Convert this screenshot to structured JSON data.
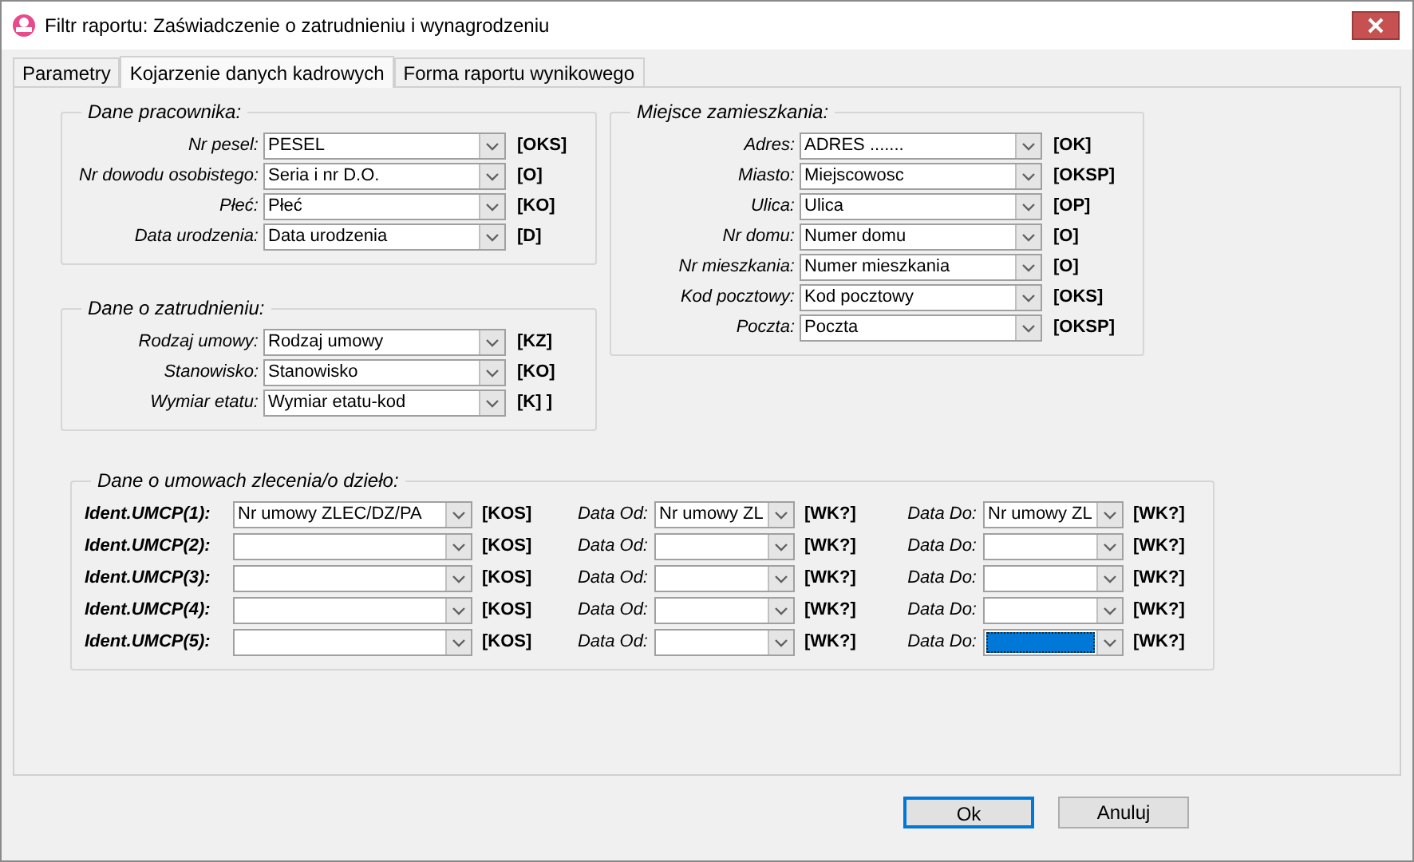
{
  "window": {
    "title": "Filtr raportu: Zaświadczenie o zatrudnieniu i wynagrodzeniu"
  },
  "tabs": [
    {
      "label": "Parametry",
      "selected": false
    },
    {
      "label": "Kojarzenie danych kadrowych",
      "selected": true
    },
    {
      "label": "Forma raportu wynikowego",
      "selected": false
    }
  ],
  "groups": [
    {
      "title": "Dane pracownika:",
      "fields": [
        {
          "label": "Nr pesel:",
          "value": "PESEL",
          "tag": "[OKS]"
        },
        {
          "label": "Nr dowodu osobistego:",
          "value": "Seria i nr D.O.",
          "tag": "[O]"
        },
        {
          "label": "Płeć:",
          "value": "Płeć",
          "tag": "[KO]"
        },
        {
          "label": "Data urodzenia:",
          "value": "Data urodzenia",
          "tag": "[D]"
        }
      ]
    },
    {
      "title": "Dane o zatrudnieniu:",
      "fields": [
        {
          "label": "Rodzaj umowy:",
          "value": "Rodzaj umowy",
          "tag": "[KZ]"
        },
        {
          "label": "Stanowisko:",
          "value": "Stanowisko",
          "tag": "[KO]"
        },
        {
          "label": "Wymiar etatu:",
          "value": "Wymiar etatu-kod",
          "tag": "[K] ]"
        }
      ]
    },
    {
      "title": "Miejsce zamieszkania:",
      "fields": [
        {
          "label": "Adres:",
          "value": "ADRES .......",
          "tag": "[OK]"
        },
        {
          "label": "Miasto:",
          "value": "Miejscowosc",
          "tag": "[OKSP]"
        },
        {
          "label": "Ulica:",
          "value": "Ulica",
          "tag": "[OP]"
        },
        {
          "label": "Nr domu:",
          "value": "Numer domu",
          "tag": "[O]"
        },
        {
          "label": "Nr mieszkania:",
          "value": "Numer mieszkania",
          "tag": "[O]"
        },
        {
          "label": "Kod pocztowy:",
          "value": "Kod pocztowy",
          "tag": "[OKS]"
        },
        {
          "label": "Poczta:",
          "value": "Poczta",
          "tag": "[OKSP]"
        }
      ]
    }
  ],
  "contracts": {
    "title": "Dane o umowach zlecenia/o dzieło:",
    "rows": [
      {
        "ident": {
          "label": "Ident.UMCP(1):",
          "value": "Nr umowy ZLEC/DZ/PA",
          "tag": "[KOS]",
          "focused": false
        },
        "od": {
          "label": "Data Od:",
          "value": "Nr umowy ZL",
          "tag": "[WK?]",
          "focused": false
        },
        "do": {
          "label": "Data Do:",
          "value": "Nr umowy ZL",
          "tag": "[WK?]",
          "focused": false
        }
      },
      {
        "ident": {
          "label": "Ident.UMCP(2):",
          "tag": "[KOS]",
          "focused": false
        },
        "od": {
          "label": "Data Od:",
          "tag": "[WK?]",
          "focused": false
        },
        "do": {
          "label": "Data Do:",
          "tag": "[WK?]",
          "focused": false
        }
      },
      {
        "ident": {
          "label": "Ident.UMCP(3):",
          "tag": "[KOS]",
          "focused": false
        },
        "od": {
          "label": "Data Od:",
          "tag": "[WK?]",
          "focused": false
        },
        "do": {
          "label": "Data Do:",
          "tag": "[WK?]",
          "focused": false
        }
      },
      {
        "ident": {
          "label": "Ident.UMCP(4):",
          "tag": "[KOS]",
          "focused": false
        },
        "od": {
          "label": "Data Od:",
          "tag": "[WK?]",
          "focused": false
        },
        "do": {
          "label": "Data Do:",
          "tag": "[WK?]",
          "focused": false
        }
      },
      {
        "ident": {
          "label": "Ident.UMCP(5):",
          "tag": "[KOS]",
          "focused": false
        },
        "od": {
          "label": "Data Od:",
          "tag": "[WK?]",
          "focused": false
        },
        "do": {
          "label": "Data Do:",
          "tag": "[WK?]",
          "focused": true
        }
      }
    ]
  },
  "buttons": [
    {
      "label": "Ok",
      "default": true
    },
    {
      "label": "Anuluj",
      "default": false
    }
  ]
}
